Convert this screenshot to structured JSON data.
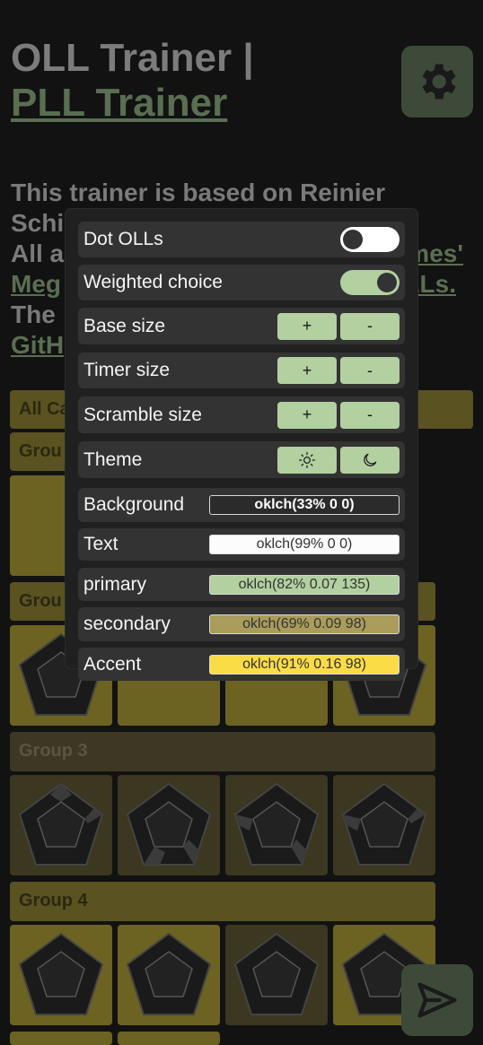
{
  "header": {
    "title": "OLL Trainer |",
    "pll_link": "PLL Trainer"
  },
  "intro": {
    "line1": "This trainer is based on Reinier",
    "line2_start": "Schi",
    "line3_start": "All a",
    "line3_link_end": "mes'",
    "line4_link_start": "Meg",
    "line4_link_end": "OLLs.",
    "line5_start": "The",
    "line6_link_start": "GitH"
  },
  "groups": {
    "all_cases": "All Ca",
    "group1": "Grou",
    "group2": "Grou",
    "group3": "Group 3",
    "group4": "Group 4"
  },
  "settings": {
    "dot_olls": {
      "label": "Dot OLLs",
      "enabled": false
    },
    "weighted_choice": {
      "label": "Weighted choice",
      "enabled": true
    },
    "base_size": {
      "label": "Base size",
      "plus": "+",
      "minus": "-"
    },
    "timer_size": {
      "label": "Timer size",
      "plus": "+",
      "minus": "-"
    },
    "scramble_size": {
      "label": "Scramble size",
      "plus": "+",
      "minus": "-"
    },
    "theme": {
      "label": "Theme",
      "light_icon": "sun-icon",
      "dark_icon": "moon-icon"
    },
    "background": {
      "label": "Background",
      "value": "oklch(33% 0 0)",
      "color": "#2b2b2b",
      "text_color": "#ffffff"
    },
    "text": {
      "label": "Text",
      "value": "oklch(99% 0 0)",
      "color": "#fcfcfc",
      "text_color": "#333333"
    },
    "primary": {
      "label": "primary",
      "value": "oklch(82% 0.07 135)",
      "color": "#b2d0a0",
      "text_color": "#333333"
    },
    "secondary": {
      "label": "secondary",
      "value": "oklch(69% 0.09 98)",
      "color": "#aa9c5a",
      "text_color": "#333333"
    },
    "accent": {
      "label": "Accent",
      "value": "oklch(91% 0.16 98)",
      "color": "#fadc47",
      "text_color": "#333333"
    }
  },
  "icons": {
    "settings": "gear-icon",
    "submit": "send-icon"
  }
}
